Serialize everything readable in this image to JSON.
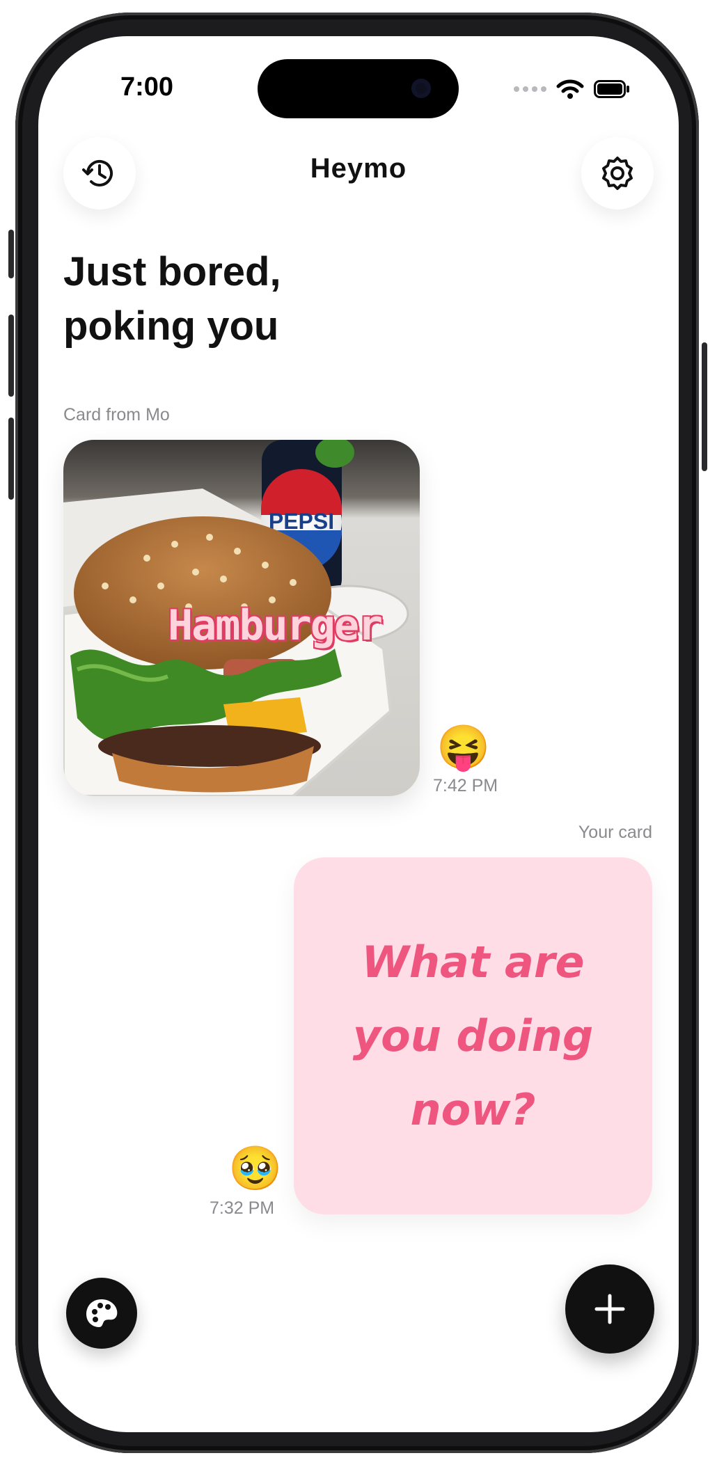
{
  "status_bar": {
    "time": "7:00",
    "signal_icon": "cellular-dots-icon",
    "wifi_icon": "wifi-icon",
    "battery_icon": "battery-icon"
  },
  "header": {
    "title": "Heymo",
    "left_icon": "history-icon",
    "right_icon": "gear-icon"
  },
  "headline": {
    "line1": "Just bored,",
    "line2": "poking you"
  },
  "received": {
    "label": "Card from Mo",
    "overlay_text": "Hamburger",
    "reaction": "😝",
    "time": "7:42 PM"
  },
  "sent": {
    "label": "Your card",
    "line1": "What are",
    "line2": "you doing",
    "line3": "now?",
    "reaction": "🥹",
    "time": "7:32 PM"
  },
  "bottom_bar": {
    "left_icon": "palette-icon",
    "right_icon": "plus-icon"
  },
  "colors": {
    "accent": "#111111",
    "note_bg": "#ffdde6",
    "note_text": "#ee5680",
    "caption": "#8a8a8e"
  }
}
